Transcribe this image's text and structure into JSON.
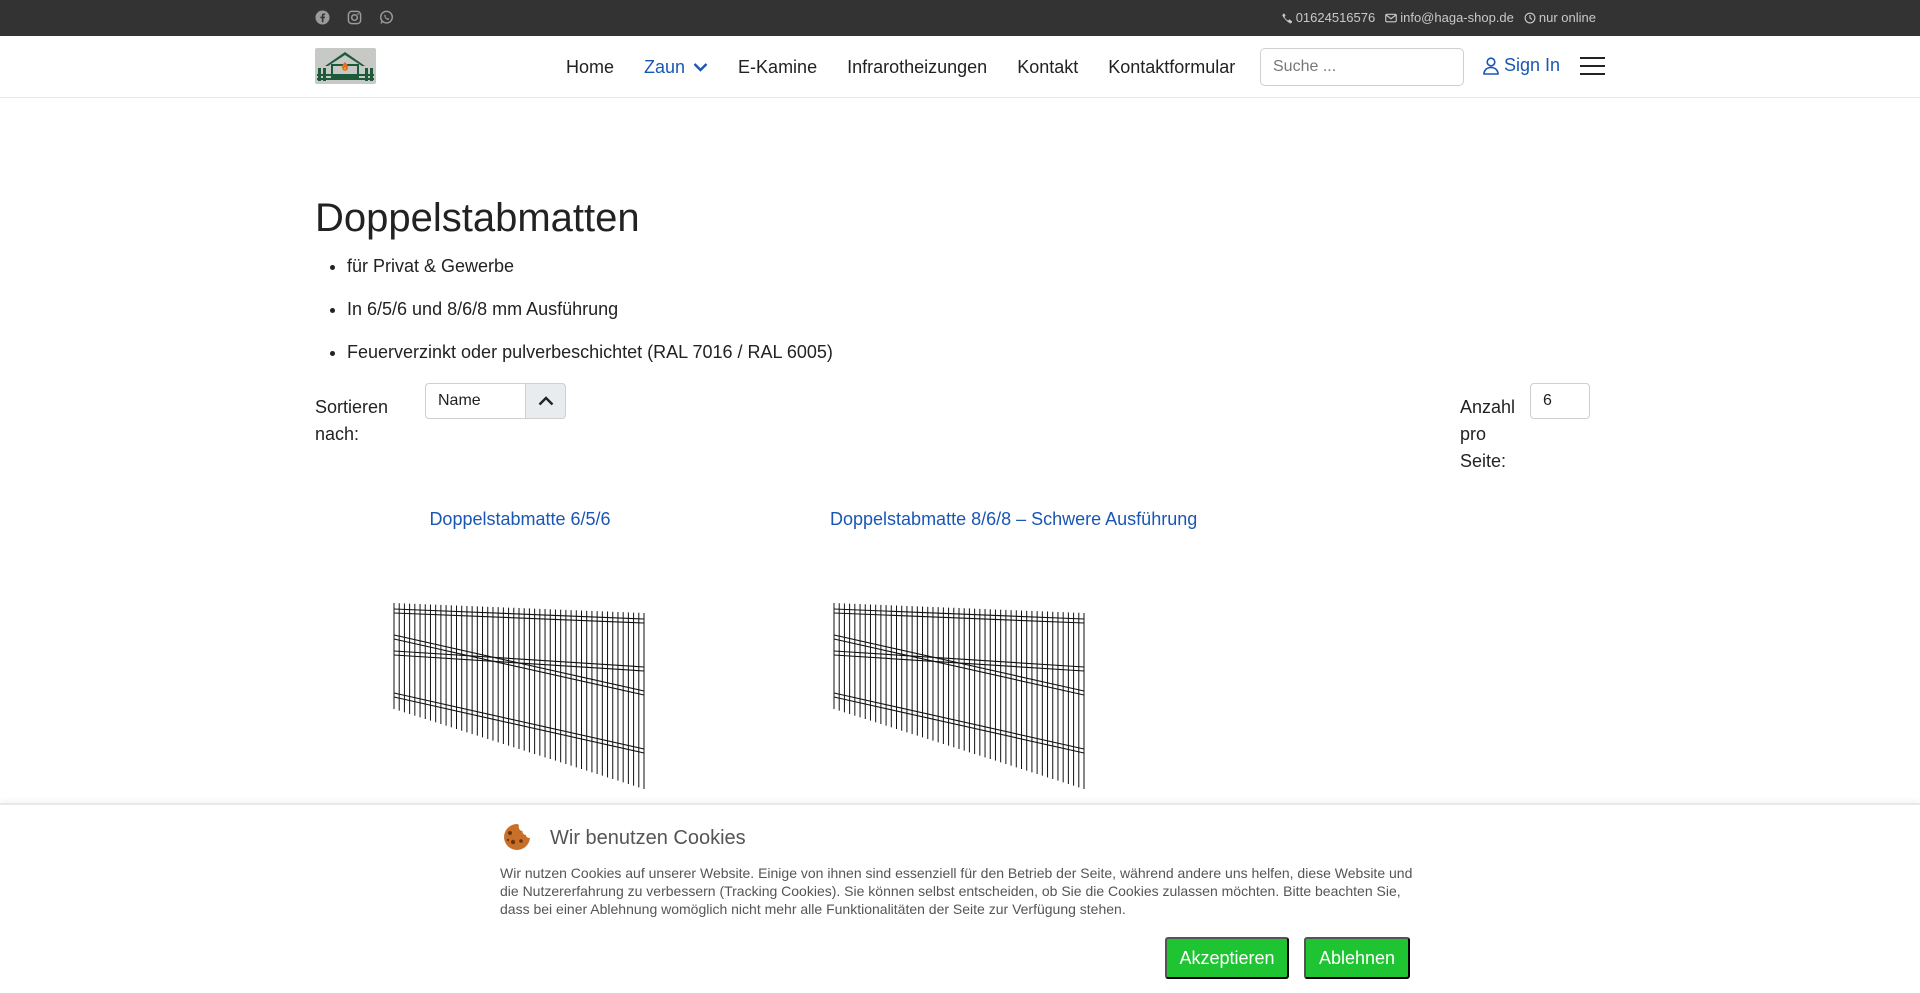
{
  "topbar": {
    "social": [
      "facebook-icon",
      "instagram-icon",
      "whatsapp-icon"
    ],
    "phone": "01624516576",
    "email": "info@haga-shop.de",
    "hours": "nur online"
  },
  "header": {
    "nav": [
      {
        "label": "Home",
        "active": false
      },
      {
        "label": "Zaun",
        "active": true,
        "dropdown": true
      },
      {
        "label": "E-Kamine",
        "active": false
      },
      {
        "label": "Infrarotheizungen",
        "active": false
      },
      {
        "label": "Kontakt",
        "active": false
      },
      {
        "label": "Kontaktformular",
        "active": false
      }
    ],
    "search_placeholder": "Suche ...",
    "signin_label": "Sign In"
  },
  "main": {
    "title": "Doppelstabmatten",
    "features": [
      "für Privat & Gewerbe",
      "In 6/5/6 und 8/6/8 mm Ausführung",
      "Feuerverzinkt oder pulverbeschichtet (RAL 7016 / RAL 6005)"
    ],
    "sort_label": "Sortieren nach:",
    "sort_value": "Name",
    "perpage_label": "Anzahl pro Seite:",
    "perpage_value": "6",
    "products": [
      {
        "title": "Doppelstabmatte 6/5/6"
      },
      {
        "title": "Doppelstabmatte 8/6/8 – Schwere Ausführung"
      }
    ]
  },
  "cookie": {
    "title": "Wir benutzen Cookies",
    "text": "Wir nutzen Cookies auf unserer Website. Einige von ihnen sind essenziell für den Betrieb der Seite, während andere uns helfen, diese Website und die Nutzererfahrung zu verbessern (Tracking Cookies). Sie können selbst entscheiden, ob Sie die Cookies zulassen möchten. Bitte beachten Sie, dass bei einer Ablehnung womöglich nicht mehr alle Funktionalitäten der Seite zur Verfügung stehen.",
    "accept_label": "Akzeptieren",
    "decline_label": "Ablehnen"
  },
  "colors": {
    "topbar": "#333333",
    "link": "#1a56b4",
    "button": "#1ec431"
  }
}
